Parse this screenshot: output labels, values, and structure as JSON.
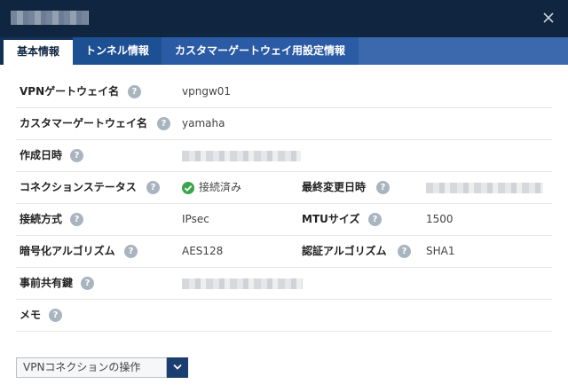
{
  "window": {
    "title_redacted": true,
    "close_glyph": "×"
  },
  "tabs": [
    {
      "label": "基本情報",
      "active": true
    },
    {
      "label": "トンネル情報",
      "active": false
    },
    {
      "label": "カスタマーゲートウェイ用設定情報",
      "active": false
    }
  ],
  "details": {
    "vpn_gateway_name": {
      "label": "VPNゲートウェイ名",
      "value": "vpngw01"
    },
    "customer_gateway_name": {
      "label": "カスタマーゲートウェイ名",
      "value": "yamaha"
    },
    "created_at": {
      "label": "作成日時",
      "value_redacted": true
    },
    "connection_status": {
      "label": "コネクションステータス",
      "value": "接続済み",
      "status_color": "#3aa54b"
    },
    "last_modified": {
      "label": "最終変更日時",
      "value_redacted": true
    },
    "connection_method": {
      "label": "接続方式",
      "value": "IPsec"
    },
    "mtu_size": {
      "label": "MTUサイズ",
      "value": "1500"
    },
    "encryption_algorithm": {
      "label": "暗号化アルゴリズム",
      "value": "AES128"
    },
    "auth_algorithm": {
      "label": "認証アルゴリズム",
      "value": "SHA1"
    },
    "pre_shared_key": {
      "label": "事前共有鍵",
      "value_redacted": true
    },
    "memo": {
      "label": "メモ",
      "value": ""
    }
  },
  "help_glyph": "?",
  "actions": {
    "dropdown_label": "VPNコネクションの操作"
  },
  "colors": {
    "titlebar": "#0f2540",
    "tab_active_bg": "#ffffff",
    "caret_bg": "#1b3e70",
    "help_icon": "#aab4bf"
  },
  "icons": [
    "close-icon",
    "help-icon",
    "check-circle-icon",
    "chevron-down-icon"
  ]
}
